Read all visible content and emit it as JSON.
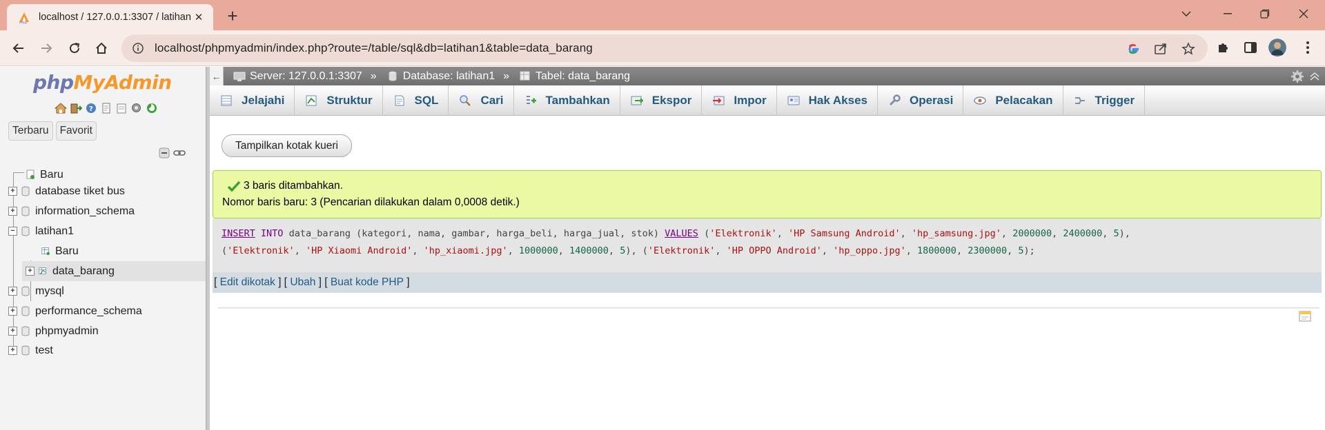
{
  "browser": {
    "tab_title": "localhost / 127.0.0.1:3307 / latihan1",
    "url": "localhost/phpmyadmin/index.php?route=/table/sql&db=latihan1&table=data_barang",
    "icons": [
      "pma-favicon",
      "close-icon",
      "plus-icon",
      "chevron-down-icon",
      "minimize-icon",
      "restore-icon",
      "window-close-icon",
      "back-icon",
      "forward-icon",
      "reload-icon",
      "home-icon",
      "info-icon",
      "google-icon",
      "share-icon",
      "star-icon",
      "puzzle-icon",
      "sidepanel-icon",
      "profile-avatar",
      "kebab-menu-icon"
    ]
  },
  "nav": {
    "logo_php": "php",
    "logo_myadmin": "MyAdmin",
    "tabs": [
      "Terbaru",
      "Favorit"
    ],
    "tree": [
      {
        "label": "Baru",
        "level": 0
      },
      {
        "label": "database tiket bus",
        "level": 0
      },
      {
        "label": "information_schema",
        "level": 0
      },
      {
        "label": "latihan1",
        "level": 0
      },
      {
        "label": "Baru",
        "level": 1
      },
      {
        "label": "data_barang",
        "level": 1
      },
      {
        "label": "mysql",
        "level": 0
      },
      {
        "label": "performance_schema",
        "level": 0
      },
      {
        "label": "phpmyadmin",
        "level": 0
      },
      {
        "label": "test",
        "level": 0
      }
    ]
  },
  "breadcrumb": {
    "server": "Server: 127.0.0.1:3307",
    "database": "Database: latihan1",
    "table": "Tabel: data_barang",
    "separator": "»"
  },
  "menu": [
    {
      "label": "Jelajahi",
      "icon": "browse-icon"
    },
    {
      "label": "Struktur",
      "icon": "structure-icon"
    },
    {
      "label": "SQL",
      "icon": "sql-icon"
    },
    {
      "label": "Cari",
      "icon": "search-icon"
    },
    {
      "label": "Tambahkan",
      "icon": "insert-icon"
    },
    {
      "label": "Ekspor",
      "icon": "export-icon"
    },
    {
      "label": "Impor",
      "icon": "import-icon"
    },
    {
      "label": "Hak Akses",
      "icon": "privileges-icon"
    },
    {
      "label": "Operasi",
      "icon": "operations-icon"
    },
    {
      "label": "Pelacakan",
      "icon": "tracking-icon"
    },
    {
      "label": "Trigger",
      "icon": "trigger-icon"
    }
  ],
  "query_button": "Tampilkan kotak kueri",
  "success": {
    "line1": "3 baris ditambahkan.",
    "line2": "Nomor baris baru: 3 (Pencarian dilakukan dalam 0,0008 detik.)"
  },
  "sql": {
    "insert": "INSERT",
    "into": "INTO",
    "table": "data_barang",
    "columns": "(kategori, nama, gambar, harga_beli, harga_jual, stok)",
    "values_kw": "VALUES",
    "rows": [
      [
        "'Elektronik'",
        "'HP Samsung Android'",
        "'hp_samsung.jpg'",
        "2000000",
        "2400000",
        "5"
      ],
      [
        "'Elektronik'",
        "'HP Xiaomi Android'",
        "'hp_xiaomi.jpg'",
        "1000000",
        "1400000",
        "5"
      ],
      [
        "'Elektronik'",
        "'HP OPPO Android'",
        "'hp_oppo.jpg'",
        "1800000",
        "2300000",
        "5"
      ]
    ]
  },
  "sql_actions": [
    "Edit dikotak",
    "Ubah",
    "Buat kode PHP"
  ],
  "colors": {
    "tabbar": "#e8aa9a",
    "success_bg": "#ebf8a4",
    "link": "#235a81"
  }
}
